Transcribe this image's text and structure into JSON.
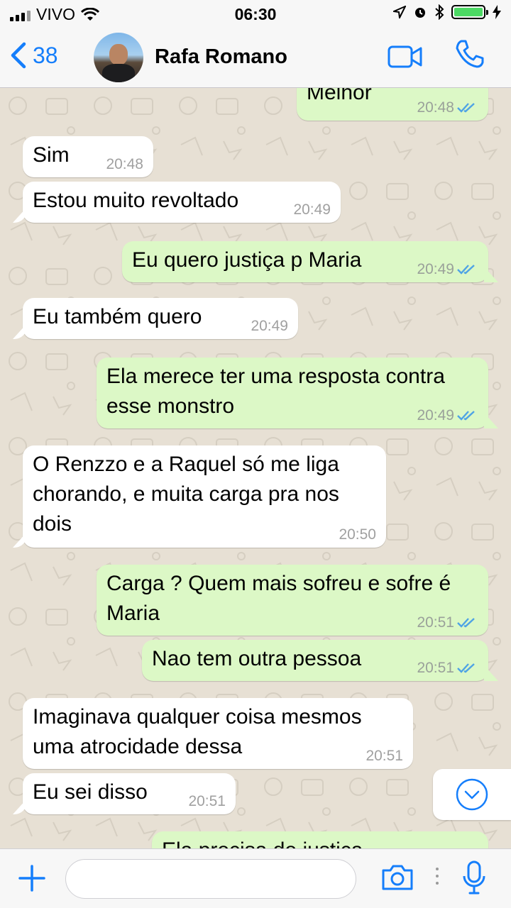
{
  "status_bar": {
    "carrier": "VIVO",
    "time": "06:30",
    "battery_level": 1.0,
    "icons": [
      "signal-icon",
      "wifi-icon",
      "location-icon",
      "alarm-icon",
      "bluetooth-icon",
      "battery-icon",
      "charging-icon"
    ]
  },
  "nav": {
    "back_count": "38",
    "contact_name": "Rafa Romano",
    "icons": [
      "back-chevron-icon",
      "avatar",
      "video-call-icon",
      "phone-icon"
    ]
  },
  "messages": [
    {
      "dir": "out",
      "text": "Melhor",
      "time": "20:48",
      "read": true
    },
    {
      "dir": "in",
      "text": "Sim",
      "time": "20:48"
    },
    {
      "dir": "in",
      "text": "Estou muito revoltado",
      "time": "20:49"
    },
    {
      "dir": "out",
      "text": "Eu quero justiça p Maria",
      "time": "20:49",
      "read": true
    },
    {
      "dir": "in",
      "text": "Eu também quero",
      "time": "20:49"
    },
    {
      "dir": "out",
      "text": "Ela merece ter uma resposta contra esse monstro",
      "time": "20:49",
      "read": true
    },
    {
      "dir": "in",
      "text": "O Renzzo e a Raquel só me liga chorando, e muita carga pra nos dois",
      "time": "20:50"
    },
    {
      "dir": "out",
      "text": "Carga ? Quem mais sofreu e sofre é Maria",
      "time": "20:51",
      "read": true
    },
    {
      "dir": "out",
      "text": "Nao tem outra pessoa",
      "time": "20:51",
      "read": true
    },
    {
      "dir": "in",
      "text": "Imaginava qualquer coisa mesmos uma atrocidade dessa",
      "time": "20:51"
    },
    {
      "dir": "in",
      "text": "Eu sei disso",
      "time": "20:51"
    },
    {
      "dir": "out",
      "text": "Ela precisa de justiça",
      "time": "",
      "read": false
    }
  ],
  "input": {
    "placeholder": "",
    "icons": [
      "plus-icon",
      "camera-icon",
      "more-dots-icon",
      "microphone-icon"
    ]
  },
  "colors": {
    "accent": "#157efb",
    "outgoing_bubble": "#dcf8c6",
    "incoming_bubble": "#ffffff",
    "background": "#e7e0d4",
    "read_ticks": "#4fa3e5"
  }
}
